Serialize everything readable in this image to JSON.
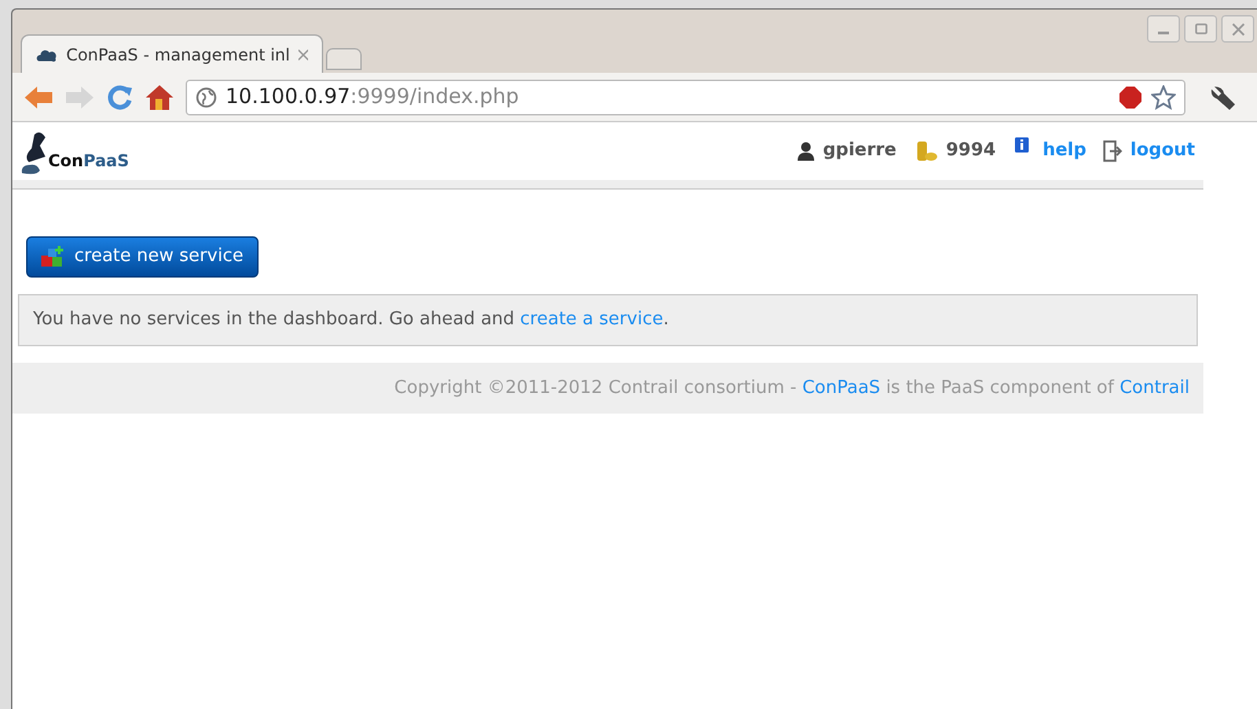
{
  "browser": {
    "tab_title": "ConPaaS - management inl",
    "url_host": "10.100.0.97",
    "url_rest": ":9999/index.php"
  },
  "header": {
    "logo": [
      "Con",
      "PaaS"
    ],
    "user": "gpierre",
    "credits": "9994",
    "help": "help",
    "logout": "logout"
  },
  "create_button": "create new service",
  "message": {
    "before": "You have no services in the dashboard. Go ahead and ",
    "link": "create a service",
    "after": "."
  },
  "footer": {
    "before": "Copyright ©2011-2012 Contrail consortium - ",
    "link1": "ConPaaS",
    "middle": " is the PaaS component of ",
    "link2": "Contrail"
  }
}
